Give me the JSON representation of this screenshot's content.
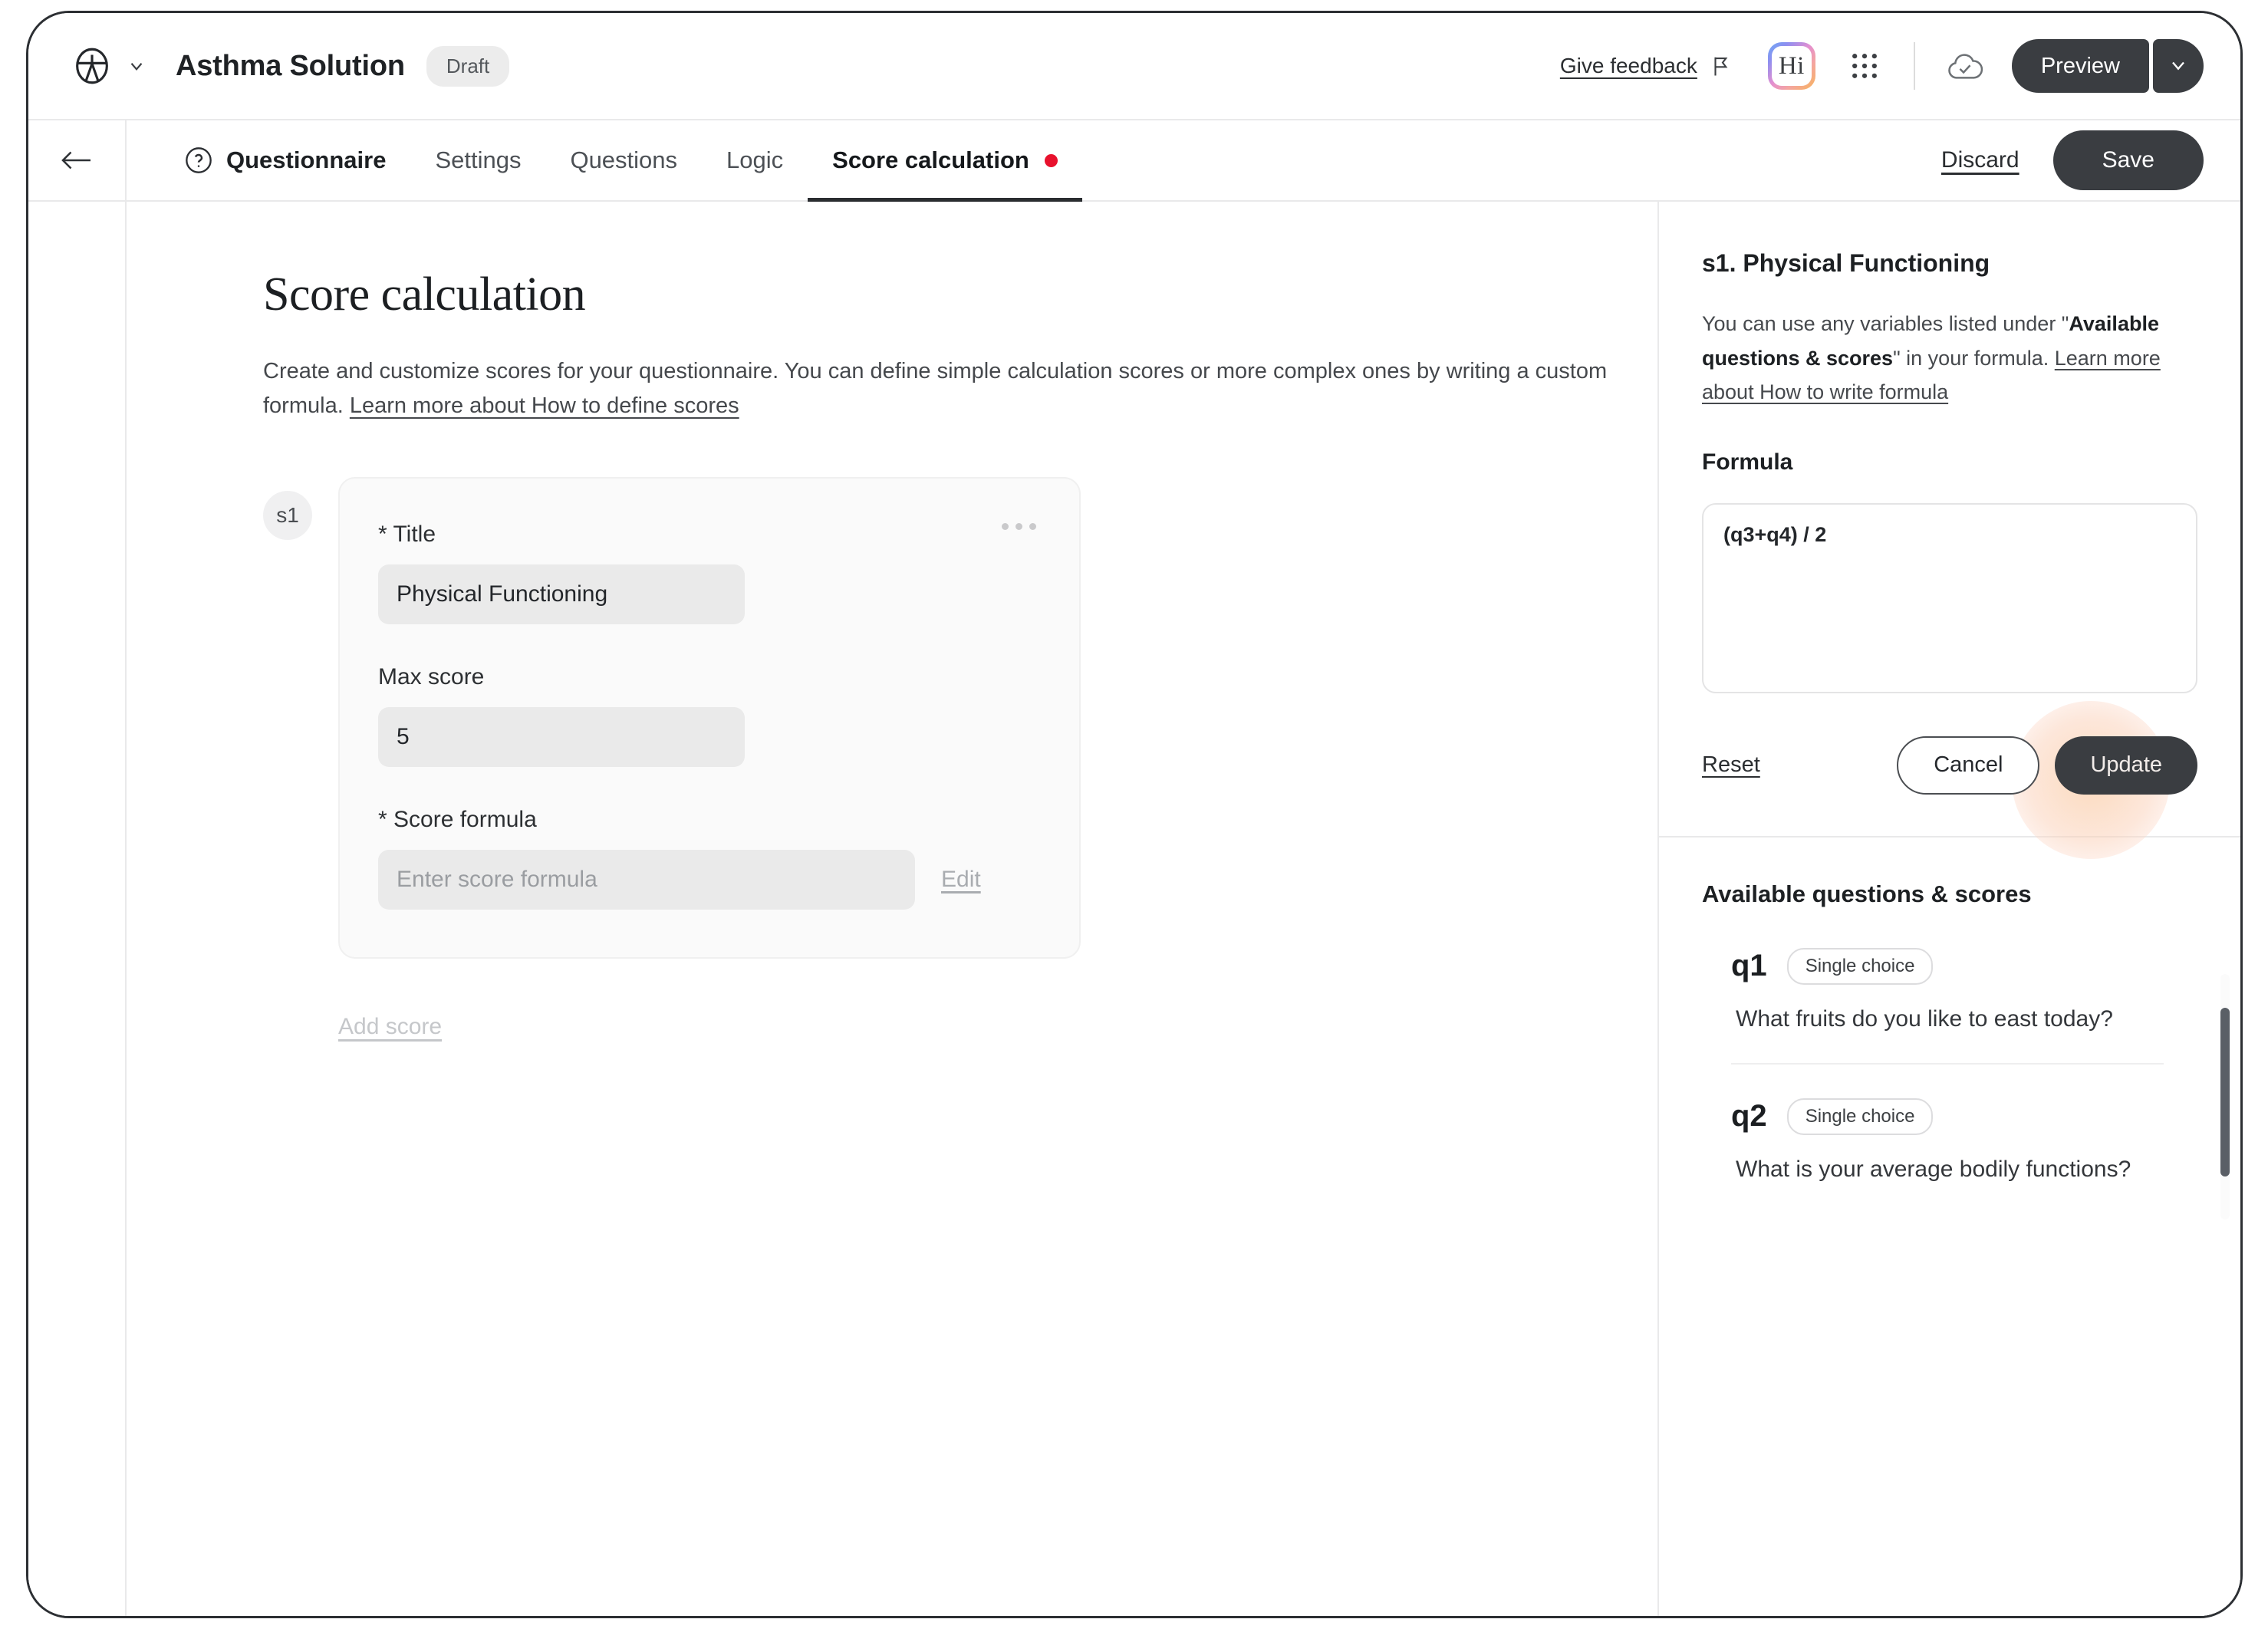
{
  "topbar": {
    "app_title": "Asthma Solution",
    "status_chip": "Draft",
    "give_feedback": "Give feedback",
    "hi_logo_text": "Hi",
    "preview_label": "Preview",
    "icons": {
      "brand": "person-circle-icon",
      "chevron": "chevron-down-icon",
      "flag": "flag-icon",
      "grid": "apps-grid-icon",
      "cloud": "cloud-check-icon",
      "preview_caret": "chevron-down-icon"
    }
  },
  "nav": {
    "back_label": "back-arrow",
    "tabs": [
      {
        "label": "Questionnaire",
        "icon": "question-circle-icon",
        "active": false,
        "home": true,
        "dot": false
      },
      {
        "label": "Settings",
        "active": false,
        "home": false,
        "dot": false
      },
      {
        "label": "Questions",
        "active": false,
        "home": false,
        "dot": false
      },
      {
        "label": "Logic",
        "active": false,
        "home": false,
        "dot": false
      },
      {
        "label": "Score calculation",
        "active": true,
        "home": false,
        "dot": true
      }
    ],
    "discard_label": "Discard",
    "save_label": "Save"
  },
  "main": {
    "title": "Score calculation",
    "description_part1": "Create and customize scores for your questionnaire. You can define simple calculation scores or more complex ones by writing a custom formula. ",
    "description_link": "Learn more about How to define scores",
    "score_card": {
      "badge": "s1",
      "title_label": "* Title",
      "title_value": "Physical Functioning",
      "max_score_label": "Max score",
      "max_score_value": "5",
      "formula_label": "* Score formula",
      "formula_placeholder": "Enter score formula",
      "edit_label": "Edit",
      "menu_icon": "more-options-icon"
    },
    "add_score_label": "Add score"
  },
  "right_panel": {
    "title": "s1. Physical Functioning",
    "desc_pre": "You can use any variables listed under \"",
    "desc_bold": "Available questions & scores",
    "desc_mid": "\" in your formula. ",
    "desc_link": "Learn more about How to write formula",
    "formula_label": "Formula",
    "formula_value": "(q3+q4) / 2",
    "reset_label": "Reset",
    "cancel_label": "Cancel",
    "update_label": "Update",
    "available_title": "Available questions & scores",
    "questions": [
      {
        "code": "q1",
        "type": "Single choice",
        "text": "What fruits do you like to east today?"
      },
      {
        "code": "q2",
        "type": "Single choice",
        "text": "What is your average bodily functions?"
      }
    ]
  },
  "colors": {
    "accent_dark": "#3a3d41",
    "alert_dot": "#e8112d",
    "highlight": "#facc96",
    "input_bg": "#eaeaea"
  }
}
